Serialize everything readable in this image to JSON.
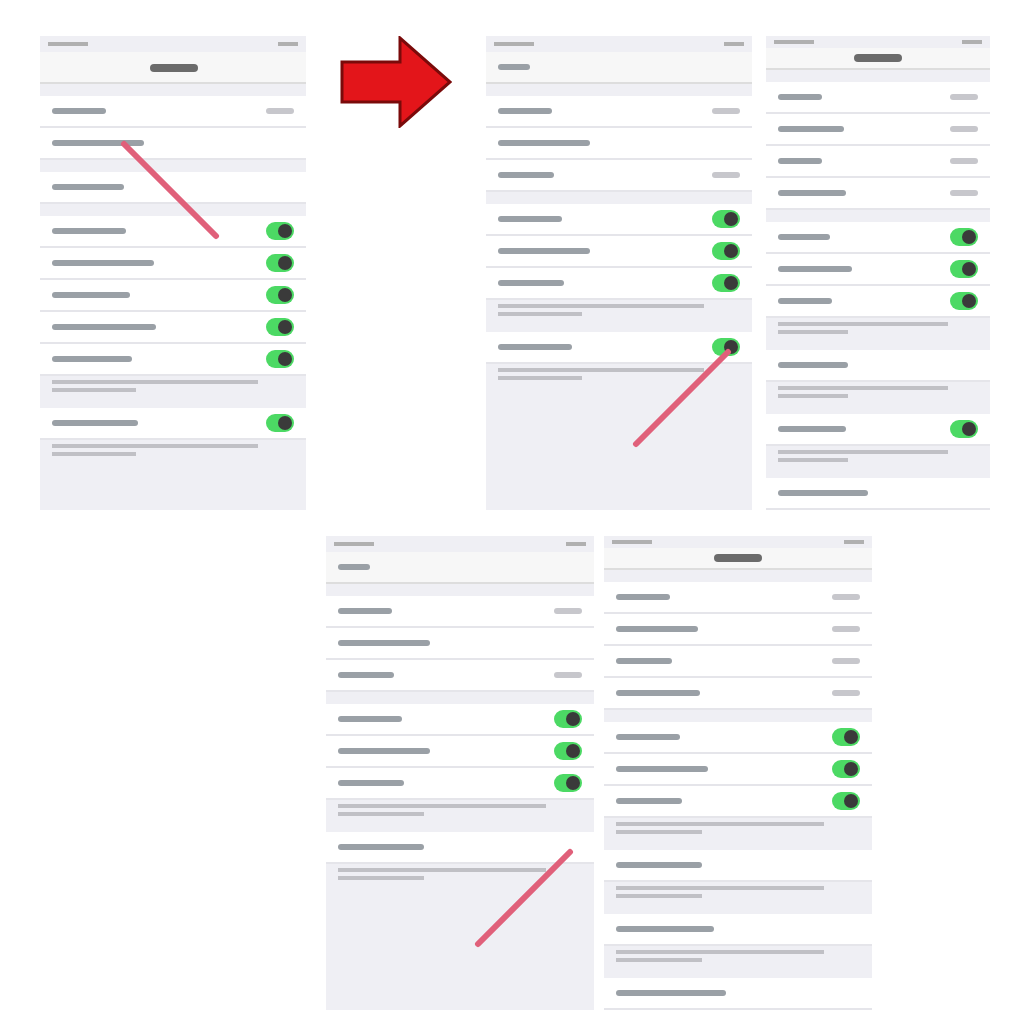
{
  "top_row": [
    {
      "kind": "screen",
      "nav": {
        "kind": "title"
      },
      "groups": [
        {
          "rows": [
            {
              "kind": "value"
            },
            {
              "kind": "link",
              "pointer": {
                "kind": "down-right"
              }
            }
          ]
        },
        {
          "rows": [
            {
              "kind": "link"
            }
          ]
        },
        {
          "rows": [
            {
              "kind": "toggle",
              "on": true
            },
            {
              "kind": "toggle",
              "on": true
            },
            {
              "kind": "toggle",
              "on": true
            },
            {
              "kind": "toggle",
              "on": true
            },
            {
              "kind": "toggle",
              "on": true
            }
          ],
          "footnote": true
        },
        {
          "rows": [
            {
              "kind": "toggle",
              "on": true
            }
          ],
          "footnote": true
        }
      ]
    },
    {
      "kind": "arrow"
    },
    {
      "kind": "screen",
      "nav": {
        "kind": "back"
      },
      "groups": [
        {
          "rows": [
            {
              "kind": "value"
            },
            {
              "kind": "link"
            },
            {
              "kind": "value"
            }
          ]
        },
        {
          "rows": [
            {
              "kind": "toggle",
              "on": true
            },
            {
              "kind": "toggle",
              "on": true
            },
            {
              "kind": "toggle",
              "on": true
            }
          ],
          "footnote": true
        },
        {
          "rows": [
            {
              "kind": "toggle",
              "on": true,
              "pointer": {
                "kind": "down-left"
              }
            }
          ],
          "footnote": true
        }
      ]
    },
    {
      "kind": "screen",
      "nav": {
        "kind": "title"
      },
      "groups": [
        {
          "rows": [
            {
              "kind": "value"
            },
            {
              "kind": "value"
            },
            {
              "kind": "value"
            },
            {
              "kind": "value"
            }
          ]
        },
        {
          "rows": [
            {
              "kind": "toggle",
              "on": true
            },
            {
              "kind": "toggle",
              "on": true
            },
            {
              "kind": "toggle",
              "on": true
            }
          ],
          "footnote": true
        },
        {
          "rows": [
            {
              "kind": "link"
            }
          ],
          "footnote": true
        },
        {
          "rows": [
            {
              "kind": "toggle",
              "on": true
            }
          ],
          "footnote": true
        },
        {
          "rows": [
            {
              "kind": "link"
            }
          ]
        }
      ]
    }
  ],
  "bottom_row": [
    {
      "kind": "screen",
      "nav": {
        "kind": "back"
      },
      "groups": [
        {
          "rows": [
            {
              "kind": "value"
            },
            {
              "kind": "link"
            },
            {
              "kind": "value"
            }
          ]
        },
        {
          "rows": [
            {
              "kind": "toggle",
              "on": true
            },
            {
              "kind": "toggle",
              "on": true
            },
            {
              "kind": "toggle",
              "on": true
            }
          ],
          "footnote": true
        },
        {
          "rows": [
            {
              "kind": "link",
              "pointer": {
                "kind": "down-left"
              }
            }
          ],
          "footnote": true
        }
      ]
    },
    {
      "kind": "screen",
      "nav": {
        "kind": "title"
      },
      "groups": [
        {
          "rows": [
            {
              "kind": "value"
            },
            {
              "kind": "value"
            },
            {
              "kind": "value"
            },
            {
              "kind": "value"
            }
          ]
        },
        {
          "rows": [
            {
              "kind": "toggle",
              "on": true
            },
            {
              "kind": "toggle",
              "on": true
            },
            {
              "kind": "toggle",
              "on": true
            }
          ],
          "footnote": true
        },
        {
          "rows": [
            {
              "kind": "link"
            }
          ],
          "footnote": true
        },
        {
          "rows": [
            {
              "kind": "link"
            }
          ],
          "footnote": true
        },
        {
          "rows": [
            {
              "kind": "link"
            }
          ]
        }
      ]
    }
  ]
}
